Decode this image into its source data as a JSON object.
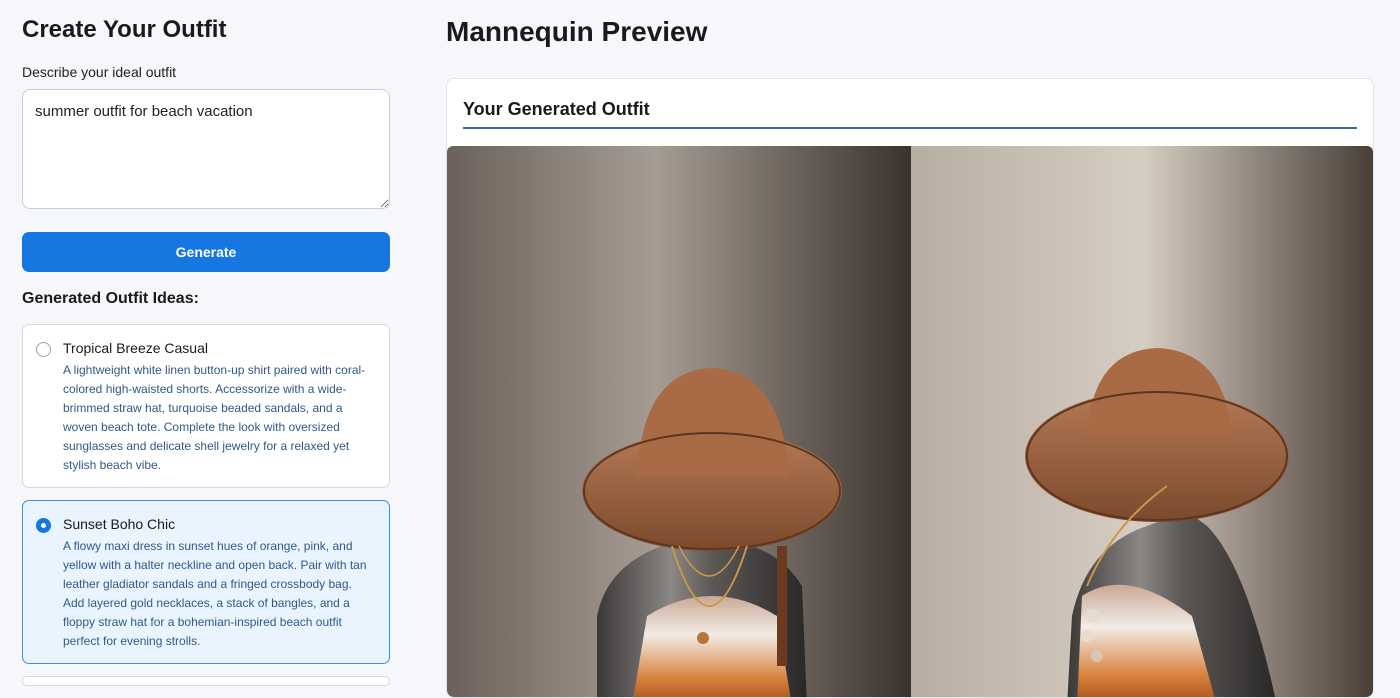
{
  "builder": {
    "title": "Create Your Outfit",
    "prompt_label": "Describe your ideal outfit",
    "prompt_value": "summer outfit for beach vacation",
    "generate_label": "Generate",
    "ideas_heading": "Generated Outfit Ideas:",
    "ideas": [
      {
        "title": "Tropical Breeze Casual",
        "description": "A lightweight white linen button-up shirt paired with coral-colored high-waisted shorts. Accessorize with a wide-brimmed straw hat, turquoise beaded sandals, and a woven beach tote. Complete the look with oversized sunglasses and delicate shell jewelry for a relaxed yet stylish beach vibe.",
        "selected": false
      },
      {
        "title": "Sunset Boho Chic",
        "description": "A flowy maxi dress in sunset hues of orange, pink, and yellow with a halter neckline and open back. Pair with tan leather gladiator sandals and a fringed crossbody bag. Add layered gold necklaces, a stack of bangles, and a floppy straw hat for a bohemian-inspired beach outfit perfect for evening strolls.",
        "selected": true
      }
    ]
  },
  "preview": {
    "title": "Mannequin Preview",
    "card_heading": "Your Generated Outfit",
    "image_subject": "mannequin wearing brown wide-brimmed hat, layered necklaces and sunset-hued halter dress, front and side views"
  },
  "colors": {
    "accent": "#1677e0",
    "selected_bg": "#eaf4ff",
    "selected_border": "#3d8fd8",
    "description_text": "#2f5a87",
    "heading_rule": "#2f6ea8"
  }
}
